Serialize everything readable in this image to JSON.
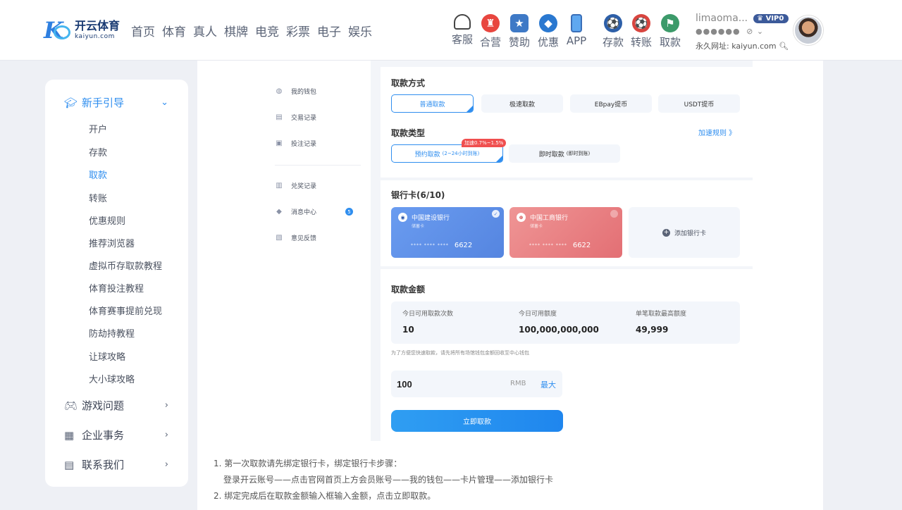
{
  "logo": {
    "cn": "开云体育",
    "en": "kaiyun.com"
  },
  "nav": [
    "首页",
    "体育",
    "真人",
    "棋牌",
    "电竞",
    "彩票",
    "电子",
    "娱乐"
  ],
  "quick_left": [
    {
      "label": "客服",
      "icon": "headset-icon"
    },
    {
      "label": "合营",
      "icon": "partner-icon"
    },
    {
      "label": "赞助",
      "icon": "sponsor-icon"
    },
    {
      "label": "优惠",
      "icon": "promo-icon"
    },
    {
      "label": "APP",
      "icon": "phone-icon"
    }
  ],
  "quick_right": [
    {
      "label": "存款",
      "icon": "deposit-icon"
    },
    {
      "label": "转账",
      "icon": "transfer-icon"
    },
    {
      "label": "取款",
      "icon": "withdraw-icon"
    }
  ],
  "user": {
    "name": "limaoma...",
    "vip": "VIP0",
    "password_mask": "●●●●●●",
    "domain": "永久网址: kaiyun.com"
  },
  "sidebar": {
    "sections": [
      {
        "label": "新手引导",
        "icon": "graduation-cap-icon",
        "expanded": true
      },
      {
        "label": "游戏问题",
        "icon": "gamepad-icon",
        "expanded": false
      },
      {
        "label": "企业事务",
        "icon": "building-icon",
        "expanded": false
      },
      {
        "label": "联系我们",
        "icon": "chat-icon",
        "expanded": false
      }
    ],
    "items": [
      "开户",
      "存款",
      "取款",
      "转账",
      "优惠规则",
      "推荐浏览器",
      "虚拟币存取款教程",
      "体育投注教程",
      "体育赛事提前兑现",
      "防劫持教程",
      "让球攻略",
      "大小球攻略"
    ],
    "active_item": "取款"
  },
  "wallet_menu": [
    {
      "label": "我的钱包",
      "icon": "wallet-icon"
    },
    {
      "label": "交易记录",
      "icon": "transaction-icon"
    },
    {
      "label": "投注记录",
      "icon": "bet-record-icon"
    },
    {
      "label": "兑奖记录",
      "icon": "prize-icon"
    },
    {
      "label": "消息中心",
      "icon": "message-icon",
      "badge": "5"
    },
    {
      "label": "意见反馈",
      "icon": "feedback-icon"
    }
  ],
  "withdraw": {
    "method_title": "取款方式",
    "methods": [
      "普通取款",
      "极速取款",
      "EBpay提币",
      "USDT提币"
    ],
    "type_title": "取款类型",
    "speed_link": "加速规则 》",
    "types": [
      {
        "label": "预约取款",
        "note": "(2~24小时到账)",
        "badge": "加速0.7%~1.5%"
      },
      {
        "label": "即时取款",
        "note": "(即时到账)"
      }
    ],
    "bank_title": "银行卡(6/10)",
    "cards": [
      {
        "bank": "中国建设银行",
        "type": "储蓄卡",
        "mask": "**** **** ****",
        "last4": "6622",
        "logo": "◉"
      },
      {
        "bank": "中国工商银行",
        "type": "储蓄卡",
        "mask": "**** **** ****",
        "last4": "6622",
        "logo": "⊕"
      }
    ],
    "add_card": "添加银行卡",
    "amount_title": "取款金额",
    "limits": [
      {
        "label": "今日可用取款次数",
        "value": "10"
      },
      {
        "label": "今日可用额度",
        "value": "100,000,000,000"
      },
      {
        "label": "单笔取款最高额度",
        "value": "49,999"
      }
    ],
    "hint": "为了方便您快速取款，请先将所有场馆钱包金额回收至中心钱包",
    "amount_value": "100",
    "currency": "RMB",
    "max_label": "最大",
    "submit": "立即取款"
  },
  "notes": {
    "line1": "1. 第一次取款请先绑定银行卡，绑定银行卡步骤：",
    "line2": "登录开云账号——点击官网首页上方会员账号——我的钱包——卡片管理——添加银行卡",
    "line3": "2. 绑定完成后在取款金额输入框输入金额，点击立即取款。"
  },
  "colors": {
    "accent": "#2f8eef",
    "ccb_card": "#5f8fe8",
    "icbc_card": "#e8797c",
    "badge_red": "#f04f4f"
  }
}
